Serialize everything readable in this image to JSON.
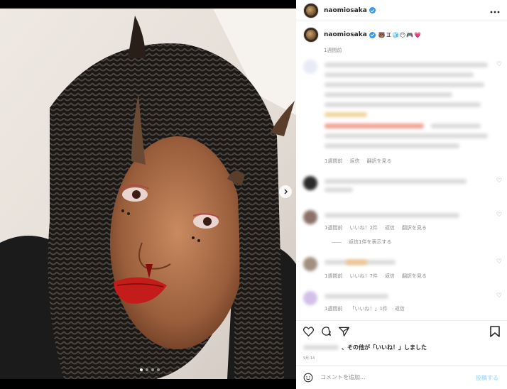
{
  "header": {
    "username": "naomiosaka",
    "more_icon": "more-horizontal-icon"
  },
  "caption": {
    "username": "naomiosaka",
    "emojis": "🐻♊🧊😶🎮💗",
    "time": "1週間前"
  },
  "carousel": {
    "total_slides": 4,
    "active_slide": 1,
    "next_icon": "chevron-right-icon"
  },
  "comments": [
    {
      "meta": [
        "1週間前",
        "返信",
        "翻訳を見る"
      ],
      "avatar_color": "#e8eaf6"
    },
    {
      "meta": [],
      "avatar_color": "#2b2b2b"
    },
    {
      "meta": [
        "1週間前",
        "いいね！2件",
        "返信",
        "翻訳を見る"
      ],
      "replies": "返信1件を表示する",
      "avatar_color": "#8a7069"
    },
    {
      "meta": [
        "1週間前",
        "いいね！7件",
        "返信",
        "翻訳を見る"
      ],
      "avatar_color": "#a09080"
    },
    {
      "meta": [
        "1週間前",
        "「いいね！」1件",
        "返信"
      ],
      "avatar_color": "#d3c0e8"
    }
  ],
  "likes": {
    "text": "、その他が「いいね！」しました"
  },
  "date": "9月 14",
  "add_comment": {
    "placeholder": "コメントを追加...",
    "post_label": "投稿する"
  },
  "colors": {
    "verified": "#3897f0",
    "secondary_text": "#8e8e8e",
    "post_button": "#b2dffc"
  }
}
